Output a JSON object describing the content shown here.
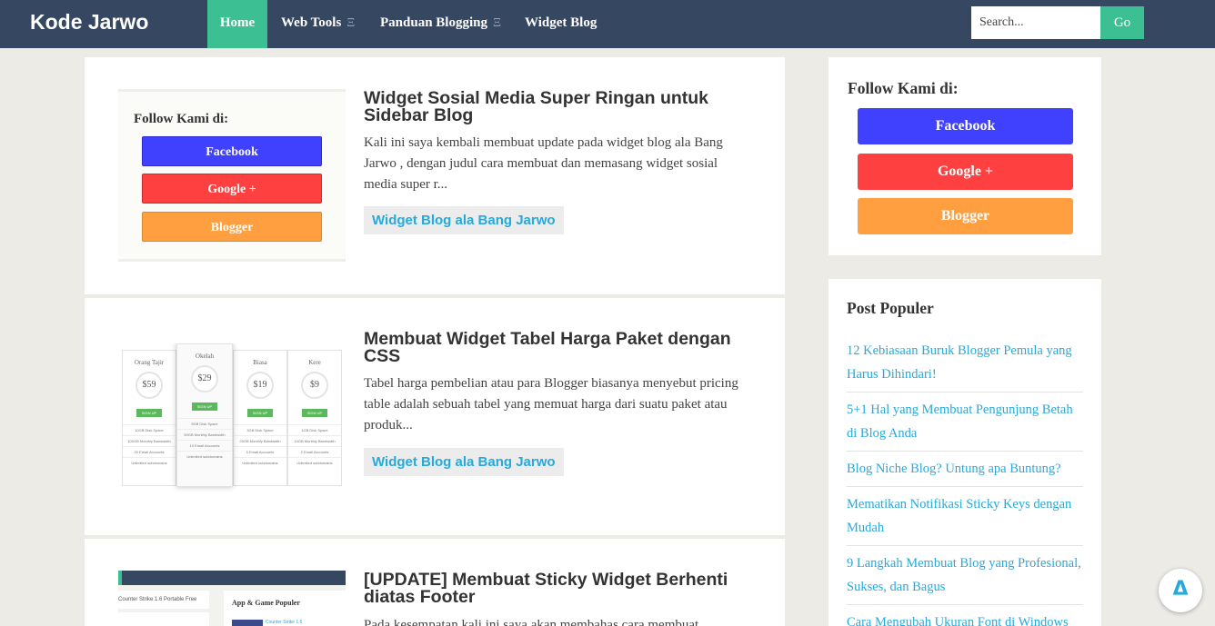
{
  "site": {
    "logo": "Kode Jarwo"
  },
  "nav": {
    "items": [
      {
        "label": "Home"
      },
      {
        "label": "Web Tools",
        "submenu_indicator": "Ξ"
      },
      {
        "label": "Panduan Blogging",
        "submenu_indicator": "Ξ"
      },
      {
        "label": "Widget Blog"
      }
    ],
    "search_placeholder": "Search...",
    "go_label": "Go"
  },
  "posts": [
    {
      "title": "Widget Sosial Media Super Ringan untuk Sidebar Blog",
      "excerpt": "Kali ini saya kembali membuat update pada widget blog ala Bang Jarwo , dengan judul cara membuat dan memasang widget sosial media super r...",
      "label": "Widget Blog ala Bang Jarwo",
      "thumb": {
        "title": "Follow Kami di:",
        "buttons": [
          "Facebook",
          "Google +",
          "Blogger"
        ]
      }
    },
    {
      "title": "Membuat Widget Tabel Harga Paket dengan CSS",
      "excerpt": "Tabel harga pembelian atau para Blogger biasanya menyebut pricing table adalah sebuah tabel yang memuat harga dari suatu paket atau produk...",
      "label": "Widget Blog ala Bang Jarwo",
      "thumb": {
        "plans": [
          {
            "name": "Orang Tajir",
            "price": "$59",
            "sign": "SIGN UP",
            "f1": "10GB Disk Space",
            "f2": "100GB Monthly Bandwidth",
            "f3": "20 Email Accounts",
            "f4": "Unlimited subdomains"
          },
          {
            "name": "Okelah",
            "price": "$29",
            "sign": "SIGN UP",
            "f1": "5GB Disk Space",
            "f2": "50GB Monthly Bandwidth",
            "f3": "10 Email Accounts",
            "f4": "Unlimited subdomains"
          },
          {
            "name": "Biasa",
            "price": "$19",
            "sign": "SIGN UP",
            "f1": "3GB Disk Space",
            "f2": "25GB Monthly Bandwidth",
            "f3": "5 Email Accounts",
            "f4": "Unlimited subdomains"
          },
          {
            "name": "Kere",
            "price": "$9",
            "sign": "SIGN UP",
            "f1": "1GB Disk Space",
            "f2": "10GB Monthly Bandwidth",
            "f3": "2 Email Accounts",
            "f4": "Unlimited subdomains"
          }
        ]
      }
    },
    {
      "title": "[UPDATE] Membuat Sticky Widget Berhenti diatas Footer",
      "excerpt": "Pada kesempatan kali ini saya akan membahas cara membuat",
      "thumb": {
        "left_text": "Counter Strike 1.6 Portable Free",
        "widget_title": "App & Game Populer",
        "item_text": "Counter Strike 1.6"
      }
    }
  ],
  "sidebar": {
    "follow": {
      "title": "Follow Kami di:",
      "buttons": [
        {
          "label": "Facebook",
          "color": "#4040ff"
        },
        {
          "label": "Google +",
          "color": "#ff4040"
        },
        {
          "label": "Blogger",
          "color": "#ff9f40"
        }
      ]
    },
    "popular": {
      "title": "Post Populer",
      "items": [
        "12 Kebiasaan Buruk Blogger Pemula yang Harus Dihindari!",
        "5+1 Hal yang Membuat Pengunjung Betah di Blog Anda",
        "Blog Niche Blog? Untung apa Buntung?",
        "Mematikan Notifikasi Sticky Keys dengan Mudah",
        "9 Langkah Membuat Blog yang Profesional, Sukses, dan Bagus",
        "Cara Mengubah Ukuran Font di Windows"
      ]
    }
  },
  "back_to_top": {
    "icon": "Δ"
  },
  "colors": {
    "nav_bg": "#364861",
    "accent_green": "#3cbf92",
    "link_blue": "#27a9d9",
    "page_bg": "#ecebe6"
  }
}
